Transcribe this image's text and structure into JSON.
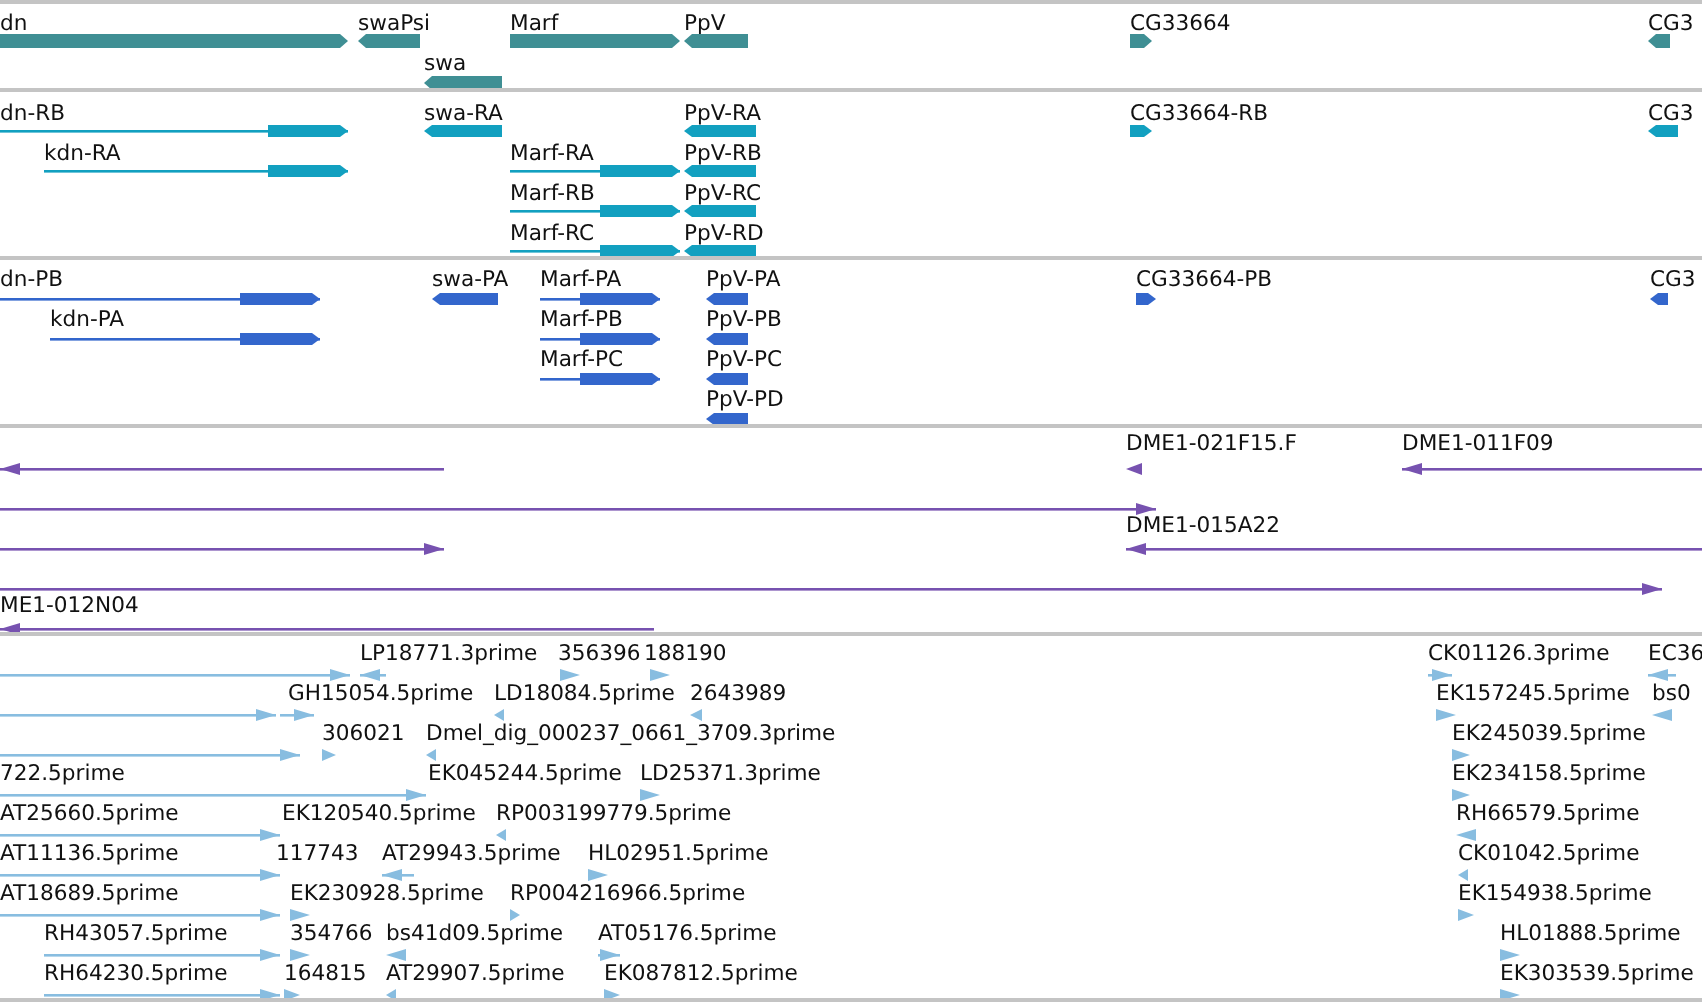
{
  "tracks": [
    {
      "kind": "gene",
      "color": "#3f8f94",
      "features": [
        {
          "label": "dn",
          "reverse": false
        },
        {
          "label": "swaPsi",
          "reverse": true
        },
        {
          "label": "Marf",
          "reverse": false
        },
        {
          "label": "PpV",
          "reverse": true
        },
        {
          "label": "swa",
          "reverse": true
        },
        {
          "label": "CG33664",
          "reverse": false
        },
        {
          "label": "CG3",
          "reverse": true
        }
      ]
    },
    {
      "kind": "transcript",
      "color": "#12a0c0",
      "features": [
        {
          "label": "dn-RB",
          "reverse": false
        },
        {
          "label": "kdn-RA",
          "reverse": false
        },
        {
          "label": "swa-RA",
          "reverse": true
        },
        {
          "label": "Marf-RA",
          "reverse": false
        },
        {
          "label": "Marf-RB",
          "reverse": false
        },
        {
          "label": "Marf-RC",
          "reverse": false
        },
        {
          "label": "PpV-RA",
          "reverse": true
        },
        {
          "label": "PpV-RB",
          "reverse": true
        },
        {
          "label": "PpV-RC",
          "reverse": true
        },
        {
          "label": "PpV-RD",
          "reverse": true
        },
        {
          "label": "CG33664-RB",
          "reverse": false
        },
        {
          "label": "CG3",
          "reverse": true
        }
      ]
    },
    {
      "kind": "transcript",
      "color": "#3366cc",
      "features": [
        {
          "label": "dn-PB",
          "reverse": false
        },
        {
          "label": "kdn-PA",
          "reverse": false
        },
        {
          "label": "swa-PA",
          "reverse": true
        },
        {
          "label": "Marf-PA",
          "reverse": false
        },
        {
          "label": "Marf-PB",
          "reverse": false
        },
        {
          "label": "Marf-PC",
          "reverse": false
        },
        {
          "label": "PpV-PA",
          "reverse": true
        },
        {
          "label": "PpV-PB",
          "reverse": true
        },
        {
          "label": "PpV-PC",
          "reverse": true
        },
        {
          "label": "PpV-PD",
          "reverse": true
        },
        {
          "label": "CG33664-PB",
          "reverse": false
        },
        {
          "label": "CG3",
          "reverse": true
        }
      ]
    },
    {
      "kind": "clone",
      "color": "#7752b0",
      "features": [
        {
          "reverse": true
        },
        {
          "label": "DME1-021F15.F",
          "reverse": true
        },
        {
          "label": "DME1-011F09",
          "reverse": true
        },
        {
          "reverse": false
        },
        {
          "reverse": false
        },
        {
          "label": "DME1-015A22",
          "reverse": true
        },
        {
          "reverse": false
        },
        {
          "label": "ME1-012N04",
          "reverse": true
        }
      ]
    },
    {
      "kind": "est",
      "color": "#88bde0",
      "features": [
        {
          "reverse": false
        },
        {
          "label": "LP18771.3prime",
          "reverse": true
        },
        {
          "label": "356396",
          "reverse": false
        },
        {
          "label": "188190",
          "reverse": false
        },
        {
          "label": "CK01126.3prime",
          "reverse": false
        },
        {
          "label": "EC36",
          "reverse": true
        },
        {
          "reverse": false
        },
        {
          "label": "GH15054.5prime",
          "reverse": false
        },
        {
          "label": "LD18084.5prime",
          "reverse": true
        },
        {
          "label": "2643989",
          "reverse": true
        },
        {
          "label": "EK157245.5prime",
          "reverse": false
        },
        {
          "label": "bs0",
          "reverse": true
        },
        {
          "reverse": false
        },
        {
          "label": "306021",
          "reverse": false
        },
        {
          "label": "Dmel_dig_000237_0661_3709.3prime",
          "reverse": true
        },
        {
          "label": "EK245039.5prime",
          "reverse": false
        },
        {
          "label": "722.5prime",
          "reverse": false
        },
        {
          "label": "EK045244.5prime"
        },
        {
          "label": "LD25371.3prime",
          "reverse": false
        },
        {
          "label": "EK234158.5prime",
          "reverse": false
        },
        {
          "label": "AT25660.5prime",
          "reverse": false
        },
        {
          "label": "EK120540.5prime"
        },
        {
          "label": "RP003199779.5prime",
          "reverse": true
        },
        {
          "label": "RH66579.5prime",
          "reverse": true
        },
        {
          "label": "AT11136.5prime",
          "reverse": false
        },
        {
          "label": "117743"
        },
        {
          "label": "AT29943.5prime",
          "reverse": true
        },
        {
          "label": "HL02951.5prime",
          "reverse": false
        },
        {
          "label": "CK01042.5prime",
          "reverse": true
        },
        {
          "label": "AT18689.5prime",
          "reverse": false
        },
        {
          "label": "EK230928.5prime",
          "reverse": false
        },
        {
          "label": "RP004216966.5prime",
          "reverse": false
        },
        {
          "label": "EK154938.5prime",
          "reverse": false
        },
        {
          "label": "RH43057.5prime",
          "reverse": false
        },
        {
          "label": "354766",
          "reverse": false
        },
        {
          "label": "bs41d09.5prime",
          "reverse": true
        },
        {
          "label": "AT05176.5prime",
          "reverse": false
        },
        {
          "label": "HL01888.5prime",
          "reverse": false
        },
        {
          "label": "RH64230.5prime",
          "reverse": false
        },
        {
          "label": "164815",
          "reverse": false
        },
        {
          "label": "AT29907.5prime",
          "reverse": true
        },
        {
          "label": "EK087812.5prime",
          "reverse": false
        },
        {
          "label": "EK303539.5prime",
          "reverse": false
        }
      ]
    }
  ]
}
